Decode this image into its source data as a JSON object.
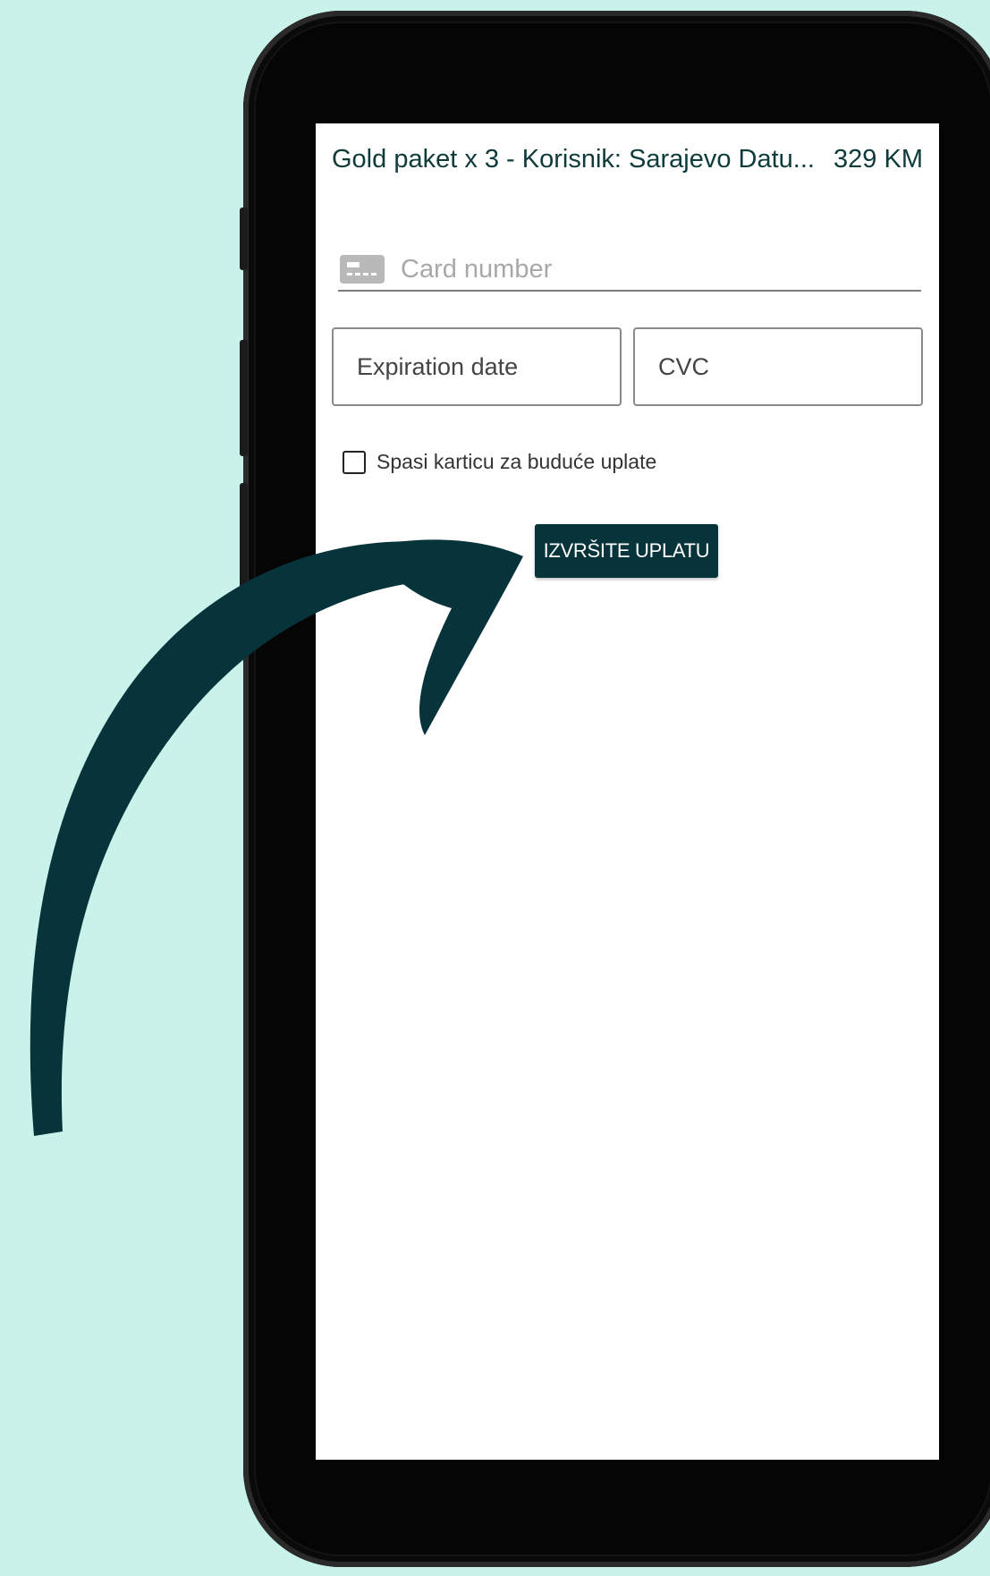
{
  "order": {
    "title": "Gold paket x 3 - Korisnik: Sarajevo Datu...",
    "price": "329 KM"
  },
  "payment_form": {
    "card_number_placeholder": "Card number",
    "expiration_placeholder": "Expiration date",
    "cvc_placeholder": "CVC",
    "save_card_label": "Spasi karticu za buduće uplate",
    "save_card_checked": false,
    "pay_button_label": "IZVRŠITE UPLATU"
  },
  "colors": {
    "background": "#c9f3ea",
    "accent": "#07343a",
    "arrow": "#07343a"
  },
  "icons": {
    "card": "credit-card-icon",
    "arrow": "curved-arrow-annotation"
  }
}
